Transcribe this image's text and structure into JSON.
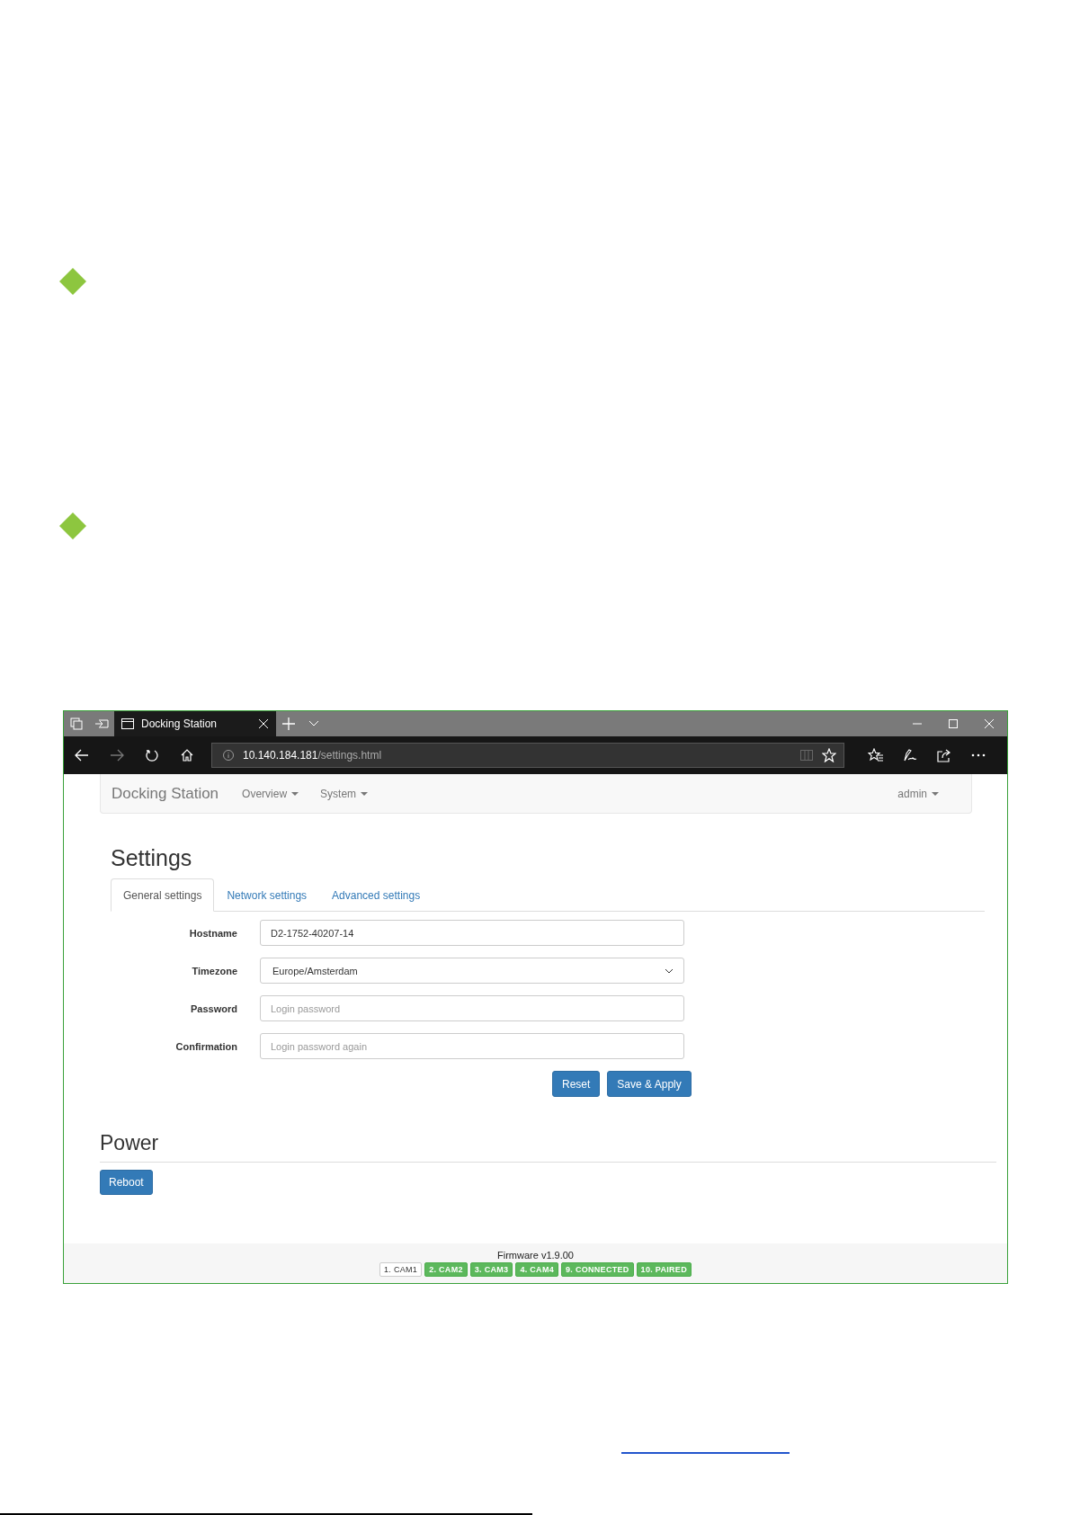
{
  "browser": {
    "tab_title": "Docking Station",
    "address_host": "10.140.184.181",
    "address_path": "/settings.html"
  },
  "navbar": {
    "brand": "Docking Station",
    "menus": [
      {
        "label": "Overview"
      },
      {
        "label": "System"
      }
    ],
    "user": "admin"
  },
  "settings": {
    "title": "Settings",
    "tabs": [
      {
        "label": "General settings",
        "selected": true
      },
      {
        "label": "Network settings",
        "selected": false
      },
      {
        "label": "Advanced settings",
        "selected": false
      }
    ],
    "fields": [
      {
        "label": "Hostname",
        "kind": "text",
        "value": "D2-1752-40207-14"
      },
      {
        "label": "Timezone",
        "kind": "select",
        "value": "Europe/Amsterdam"
      },
      {
        "label": "Password",
        "kind": "text",
        "placeholder": "Login password"
      },
      {
        "label": "Confirmation",
        "kind": "text",
        "placeholder": "Login password again"
      }
    ],
    "buttons": [
      "Reset",
      "Save & Apply"
    ]
  },
  "power": {
    "title": "Power",
    "button": "Reboot"
  },
  "footer": {
    "firmware": "Firmware v1.9.00",
    "badges": [
      {
        "label": "1. CAM1",
        "on": false
      },
      {
        "label": "2. CAM2",
        "on": true
      },
      {
        "label": "3. CAM3",
        "on": true
      },
      {
        "label": "4. CAM4",
        "on": true
      },
      {
        "label": "9. CONNECTED",
        "on": true
      },
      {
        "label": "10. PAIRED",
        "on": true
      }
    ]
  }
}
